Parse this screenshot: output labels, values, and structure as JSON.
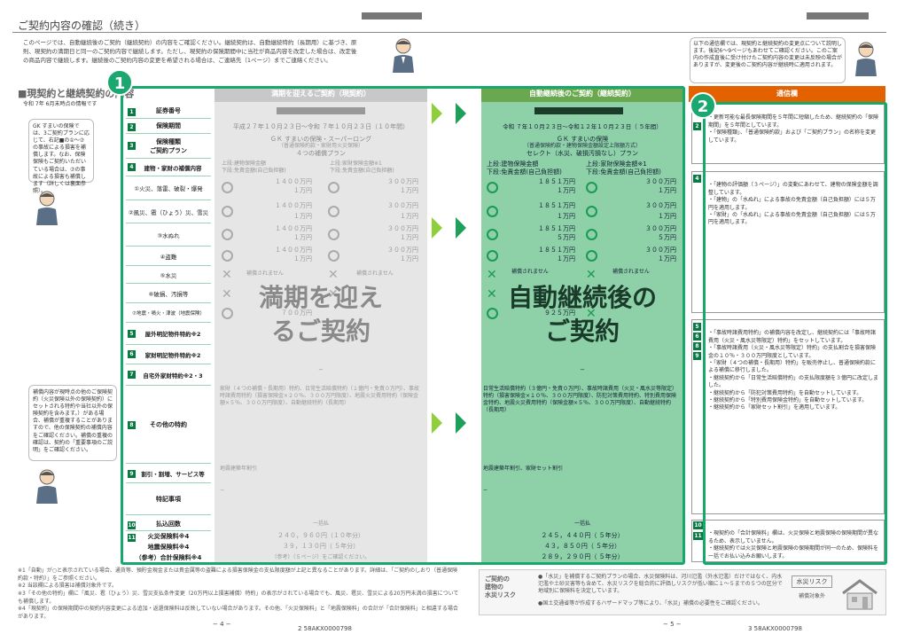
{
  "page": {
    "title": "ご契約内容の確認（続き）",
    "intro": "このページでは、自動継続後のご契約（継続契約）の内容をご確認ください。継続契約は、自動継続特約（長期用）に基づき、原則、現契約の満期日と同一のご契約内容で継続します。ただし、現契約の保険期間中に当社が商品内容を改定した場合は、改定後の商品内容で継続します。継続後のご契約内容の変更を希望される場合は、ご連絡先（1ページ）までご連絡ください。",
    "section_heading": "■現契約と継続契約の内容",
    "as_of": "令和 7年 6月末時点の情報です",
    "badge1": "1",
    "badge2": "2"
  },
  "side_notes": {
    "note1": "GK すまいの保険では、3ご契約プランに応じて、右記■の①〜⑦の事故による損害を補償します。なお、保険保険もご契約いただいている場合は、⑦の事故による損害も補償します（詳しくは裏面参照）。",
    "note2": "補償内容が現時点の他のご保険契約（火災保険以外の保険契約）にセットされる特約や当社以外の保険契約を含みます。）がある場合、補償が重複することがありますので、他の保険契約の補償内容をご確認ください。補償の重複の確認は、契約の「重要事項のご説明」をご確認ください。"
  },
  "rows": [
    {
      "num": "1",
      "label": "証券番号"
    },
    {
      "num": "2",
      "label": "保険期間"
    },
    {
      "num": "3",
      "label": "保険種類\nご契約プラン"
    },
    {
      "num": "4",
      "label": "建物・家財の補償内容"
    },
    {
      "num": "",
      "label": "①火災、落雷、破裂・爆発"
    },
    {
      "num": "",
      "label": "②風災、雹（ひょう）災、雪災"
    },
    {
      "num": "",
      "label": "③水ぬれ"
    },
    {
      "num": "",
      "label": "④盗難"
    },
    {
      "num": "",
      "label": "⑤水災"
    },
    {
      "num": "",
      "label": "⑥破損、汚損等"
    },
    {
      "num": "",
      "label": "⑦地震・噴火・津波（地震保険）"
    },
    {
      "num": "5",
      "label": "屋外明記物件特約※2"
    },
    {
      "num": "6",
      "label": "家財明記物件特約※2"
    },
    {
      "num": "7",
      "label": "自宅外家財特約※2・3"
    },
    {
      "num": "8",
      "label": "その他の特約"
    },
    {
      "num": "9",
      "label": "割引・割増、サービス等"
    },
    {
      "num": "",
      "label": "特記事項"
    },
    {
      "num": "10",
      "label": "払込回数"
    },
    {
      "num": "11",
      "label": "火災保険料※4"
    },
    {
      "num": "",
      "label": "地震保険料※4"
    },
    {
      "num": "",
      "label": "（参考）合計保険料※4"
    }
  ],
  "current": {
    "header": "満期を迎えるご契約（現契約）",
    "period": "平成２７年１０月２３日〜令和 ７年１０月２３日（１０年間）",
    "plan1": "ＧＫ すまいの保険・スーパーロング",
    "plan2": "（普通保険約款・家財用火災保険）",
    "plan3": "４つの補償プラン",
    "bld_h1": "上段:建物保険金額",
    "bld_h2": "下段:免責金額(自己負担額)",
    "con_h1": "上段:家財保険金額※1",
    "con_h2": "下段:免責金額(自己負担額)",
    "v1a": "１４００万円",
    "v1b": "１万円",
    "v1c": "３００万円",
    "v1d": "１万円",
    "v2a": "１４００万円",
    "v2b": "１万円",
    "v2c": "３００万円",
    "v2d": "１万円",
    "v3a": "１４００万円",
    "v3b": "１万円",
    "v3c": "３００万円",
    "v3d": "１万円",
    "v4a": "１４００万円",
    "v4b": "１万円",
    "v4c": "３００万円",
    "v4d": "１万円",
    "notcovered": "補償されません",
    "v7": "７００万円",
    "dash": "−",
    "other_riders": "家財（４つの補償・長期用）特約、日常生活賠償特約（１億円・免責０万円）、事故時諸費用特約（損害保険金×２０％、３００万円限度）、地震火災費用特約（保険金額×５％、３００万円限度）、自動継続特約（長期用）",
    "discount": "地震建築年割引",
    "special": "−",
    "pay": "一括払",
    "fire_prem": "２４０，９６０円（１０年分）",
    "eq_prem": "３９，１３０円（ ５年分）",
    "total_note": "（参考）（５ページ）をご確認ください。",
    "overlay": "満期を迎え\nるご契約"
  },
  "renewal": {
    "header": "自動継続後のご契約（継続契約）",
    "period": "令和 ７年１０月２３日〜令和１２年１０月２３日（ ５年間）",
    "plan1": "ＧＫ すまいの保険",
    "plan2": "（普通保険約款・建物保険金額設定上限額方式）",
    "plan3": "セレクト（水災、破損汚損なし）プラン",
    "bld_h1": "上段:建物保険金額",
    "bld_h2": "下段:免責金額(自己負担額)",
    "con_h1": "上段:家財保険金額※1",
    "con_h2": "下段:免責金額(自己負担額)",
    "v1a": "１８５１万円",
    "v1b": "１万円",
    "v1c": "３００万円",
    "v1d": "１万円",
    "v2a": "１８５１万円",
    "v2b": "１万円",
    "v2c": "３００万円",
    "v2d": "１万円",
    "v3a": "１８５１万円",
    "v3b": "５万円",
    "v3c": "３００万円",
    "v3d": "５万円",
    "v4a": "１８５１万円",
    "v4b": "１万円",
    "v4c": "３００万円",
    "v4d": "１万円",
    "notcovered": "補償されません",
    "v7": "９２５万円",
    "dash": "−",
    "other_riders": "日常生活賠償特約（３億円・免責０万円）、事故時諸費用（火災・風水災等限定）特約（損害保険金×１０％、３００万円限度）、防犯対策費用特約、特別費用保険金特約、地震火災費用特約（保険金額×５％、３００万円限度）、自動継続特約（長期用）",
    "discount": "地震建築年割引、家財セット割引",
    "special": "−",
    "pay": "一括払",
    "fire_prem": "２４５，４４０円（ ５年分）",
    "eq_prem": "４３，８５０円（ ５年分）",
    "total_prem": "２８９，２９０円（ ５年分）",
    "overlay": "自動継続後の\nご契約"
  },
  "comm": {
    "header": "通信欄",
    "intro_box": "以下の通信欄では、現契約と継続契約の変更点について説明します。後記6〜9ページもあわせてご確認ください。このご案内の作成直後に受け付けたご契約内容の変更は未反映の場合がありますが、変更後のご契約内容が継続時に適用されます。",
    "c1": "・更新可能な最長保険期間を５年間に短縮したため、継続契約の「保険期間」を５年間としています。\n・「保険種類」、「普通保険約款」および「ご契約プラン」の名称を変更しています。",
    "c2": "・「建物の評価額（３ページ）」の変動にあわせて、建物の保険金額を調整しています。\n・「建物」の「水ぬれ」による事故の免責金額（自己負担額）には５万円を適用します。\n・「家財」の「水ぬれ」による事故の免責金額（自己負担額）には５万円を適用します。",
    "c3": "・「事故時諸費用特約」の補償内容を改定し、継続契約には「事故時諸費用（火災・風水災等限定）特約」をセットしています。\n・「事故時諸費用（火災・風水災等限定）特約」の支払割合を損害保険金の１０％・３００万円限度としています。\n・「家財（４つの補償・長期用）特約」を販売停止し、普通保険約款による補償に移行しました。\n・継続契約から「日常生活賠償特約」の支払限度額を３億円に改定しました。\n・継続契約から「防犯対策費用特約」を自動セットしています。\n・継続契約から「特別費用保険金特約」を自動セットしています。\n・継続契約から「家財セット割引」を適用しています。",
    "c4": "・現契約の「合計保険料」欄は、火災保険と地震保険の保険期間が異なるため、表示していません。\n・継続契約では火災保険と地震保険の保険期間が同一のため、保険料を一括でお払い込みお願いします。"
  },
  "footer": {
    "notes": "※1「自動」が○と表示されている場合、通貨等、預貯金現金または貴金属等の盗難による損害保険金の支払限度額が上記と異なることがあります。詳細は、「ご契約のしおり（普通保険約款・特約）」をご参照ください。\n※2 当該欄による損害は補償対象外です。\n※3「その他の特約」欄に「風災、雹（ひょう）災、雪災支払条件変更（20万円以上損害補償）特約」の表示がされている場合でも、風災、雹災、雪災による20万円未満の損害についても補償します。\n※4「現契約」の保険期間中の契約内容変更による追加・返還保険料は反映していない場合があります。その他、「火災保険料」と「地震保険料」の合計が「合計保険料」と相違する場合があります。",
    "flood_title": "ご契約の\n建物の\n水災リスク",
    "flood_text1": "●「水災」を補償するご契約プランの場合、水災保険料は、河川氾濫（外水氾濫）だけではなく、内水氾濫や土砂災害等も含めて、水災リスクを総合的に評価しリスクが低い順に１〜５までの５つの区分で地域別に保険料を決定しています。",
    "flood_text2": "●国土交通省等が作成するハザードマップ等により、「水災」補償の必要性をご確認ください。",
    "flood_label": "水災リスク",
    "flood_value": "補償対象外",
    "page_left": "− 4 −",
    "code_left": "2  58AKX0000798",
    "page_right": "− 5 −",
    "code_right": "3  58AKX0000798"
  }
}
